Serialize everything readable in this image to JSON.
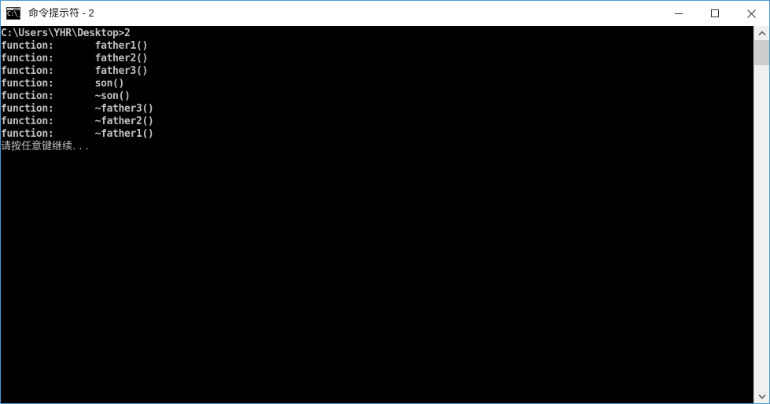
{
  "window": {
    "title": "命令提示符 - 2",
    "icon": "cmd-icon",
    "icon_glyph": "C:\\_",
    "accent_border_color": "#4f9ad0",
    "titlebar_bg": "#ffffff",
    "title_color": "#1a1a1a"
  },
  "title_buttons": {
    "minimize_label": "—",
    "maximize_label": "□",
    "close_label": "✕"
  },
  "console": {
    "background_color": "#000000",
    "foreground_color": "#c0c0c0",
    "lines": [
      "C:\\Users\\YHR\\Desktop>2",
      "function:       father1()",
      "function:       father2()",
      "function:       father3()",
      "function:       son()",
      "function:       ~son()",
      "function:       ~father3()",
      "function:       ~father2()",
      "function:       ~father1()",
      "请按任意键继续. . ."
    ],
    "prompt_path": "C:\\Users\\YHR\\Desktop",
    "command": "2",
    "press_any_key": "请按任意键继续. . ."
  },
  "scrollbar": {
    "up_arrow": "scroll-up-arrow",
    "down_arrow": "scroll-down-arrow",
    "thumb_color": "#cdcdcd",
    "track_color": "#f0f0f0"
  }
}
